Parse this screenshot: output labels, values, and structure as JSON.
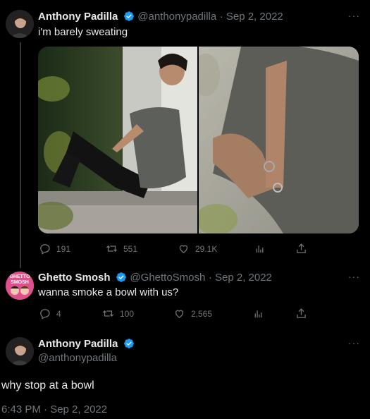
{
  "tweets": [
    {
      "name": "Anthony Padilla",
      "handle": "@anthonypadilla",
      "date": "· Sep 2, 2022",
      "text": "i'm barely sweating",
      "replies": "191",
      "retweets": "551",
      "likes": "29.1K"
    },
    {
      "name": "Ghetto Smosh",
      "handle": "@GhettoSmosh",
      "date": "· Sep 2, 2022",
      "text": "wanna smoke a bowl with us?",
      "replies": "4",
      "retweets": "100",
      "likes": "2,565",
      "avatar_text": "GHETTO SMOSH"
    }
  ],
  "main_tweet": {
    "name": "Anthony Padilla",
    "handle": "@anthonypadilla",
    "text": "why stop at a bowl",
    "timestamp": "6:43 PM · Sep 2, 2022"
  },
  "more_label": "···",
  "colors": {
    "background": "#000000",
    "text": "#e7e9ea",
    "secondary": "#71767b",
    "verified": "#1d9bf0",
    "ghetto_avatar": "#e0508c"
  }
}
